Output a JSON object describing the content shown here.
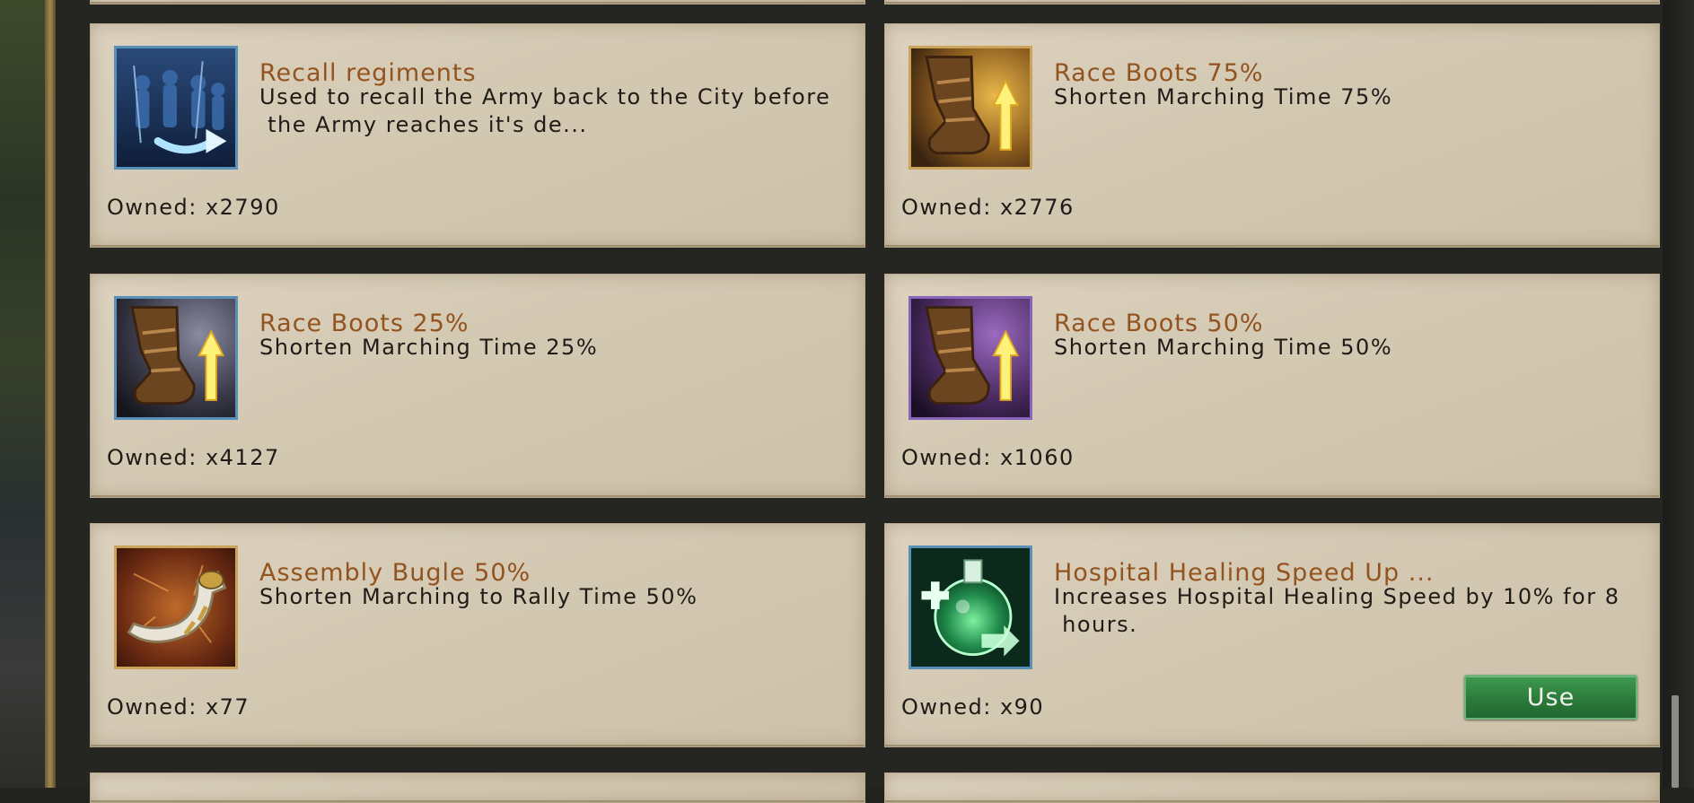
{
  "items": [
    {
      "title": "Recall regiments",
      "desc": "Used to recall the Army back to the City before\n the Army reaches it's de...",
      "owned": "Owned: x2790",
      "icon": "recall-regiments-icon"
    },
    {
      "title": "Race Boots 75%",
      "desc": "Shorten Marching Time 75%",
      "owned": "Owned: x2776",
      "icon": "race-boots-icon"
    },
    {
      "title": "Race Boots 25%",
      "desc": "Shorten Marching Time 25%",
      "owned": "Owned: x4127",
      "icon": "race-boots-icon"
    },
    {
      "title": "Race Boots 50%",
      "desc": "Shorten Marching Time 50%",
      "owned": "Owned: x1060",
      "icon": "race-boots-icon"
    },
    {
      "title": "Assembly Bugle 50%",
      "desc": "Shorten Marching to Rally Time 50%",
      "owned": "Owned: x77",
      "icon": "horn-icon"
    },
    {
      "title": "Hospital Healing Speed Up ...",
      "desc": "Increases Hospital Healing Speed by 10% for 8\n hours.",
      "owned": "Owned: x90",
      "icon": "healing-potion-icon"
    }
  ],
  "use_button_label": "Use",
  "colors": {
    "title": "#93531f",
    "card": "#d6cbb6",
    "use_button": "#2d7e3c",
    "border_blue": "#5a8fb8",
    "border_gold": "#c9a45a",
    "border_purple": "#8a64b8"
  }
}
